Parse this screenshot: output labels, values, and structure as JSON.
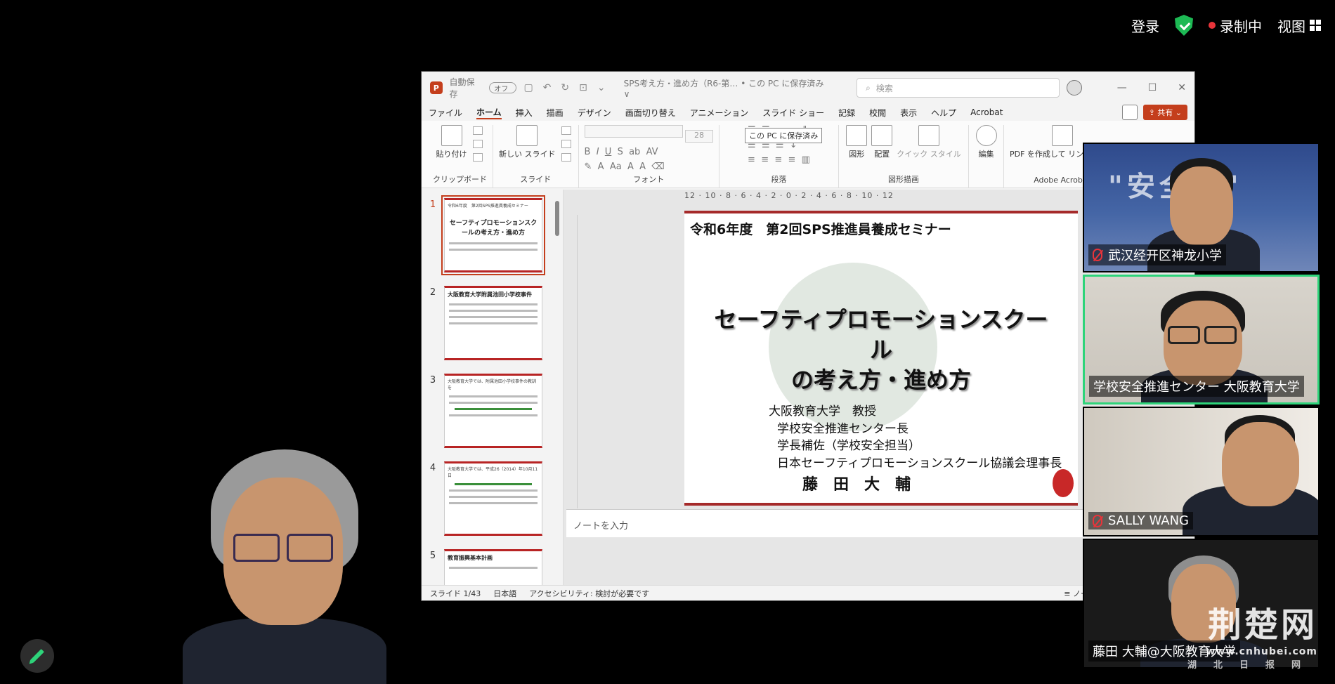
{
  "topbar": {
    "login": "登录",
    "recording": "录制中",
    "view": "视图"
  },
  "ppt": {
    "autosave": "自動保存",
    "autosave_state": "オフ",
    "doc_title": "SPS考え方・進め方（R6-第… • この PC に保存済み ∨",
    "search_placeholder": "検索",
    "menu": [
      "ファイル",
      "ホーム",
      "挿入",
      "描画",
      "デザイン",
      "画面切り替え",
      "アニメーション",
      "スライド ショー",
      "記録",
      "校閲",
      "表示",
      "ヘルプ",
      "Acrobat"
    ],
    "share": "共有",
    "tooltip": "この PC に保存済み",
    "ribbon": {
      "paste": "貼り付け",
      "clipboard": "クリップボード",
      "new_slide": "新しい スライド",
      "slides": "スライド",
      "font_size": "28",
      "font": "フォント",
      "paragraph": "段落",
      "shapes": "図形",
      "arrange": "配置",
      "quick_style": "クイック スタイル",
      "drawing": "図形描画",
      "edit": "編集",
      "pdf": "PDF を作成して リンクを共有",
      "acrobat": "Adobe Acrobat"
    },
    "thumbs": [
      {
        "num": "1",
        "title": "セーフティプロモーションスクールの考え方・進め方",
        "head": "令和6年度　第2回SPS推進員養成セミナー"
      },
      {
        "num": "2",
        "title": "大阪教育大学附属池田小学校事件"
      },
      {
        "num": "3",
        "title": "大阪教育大学では、附属池田小学校事件の教訓を"
      },
      {
        "num": "4",
        "title": "大阪教育大学では、平成26（2014）年10月11日"
      },
      {
        "num": "5",
        "title": "教育振興基本計画"
      }
    ],
    "ruler": "12 · 10 · 8 · 6 · 4 · 2 · 0 · 2 · 4 · 6 · 8 · 10 · 12",
    "slide": {
      "top": "令和6年度　第2回SPS推進員養成セミナー",
      "title1": "セーフティプロモーションスクール",
      "title2": "の考え方・進め方",
      "body": [
        "大阪教育大学　教授",
        "学校安全推進センター長",
        "学長補佐（学校安全担当）",
        "日本セーフティプロモーションスクール協議会理事長"
      ],
      "name": "藤田大輔"
    },
    "notes": "ノートを入力",
    "status": {
      "slide": "スライド 1/43",
      "lang": "日本語",
      "access": "アクセシビリティ: 検討が必要です",
      "notes": "ノート"
    }
  },
  "tiles": [
    {
      "name": "武汉经开区神龙小学",
      "muted": true
    },
    {
      "name": "学校安全推進センター 大阪教育大学",
      "muted": false
    },
    {
      "name": "SALLY WANG",
      "muted": true
    },
    {
      "name": "藤田 大輔@大阪教育大学",
      "muted": false
    }
  ],
  "watermark": {
    "line1": "荆楚网",
    "line2": "www.cnhubei.com",
    "line3": "湖北日报网"
  }
}
